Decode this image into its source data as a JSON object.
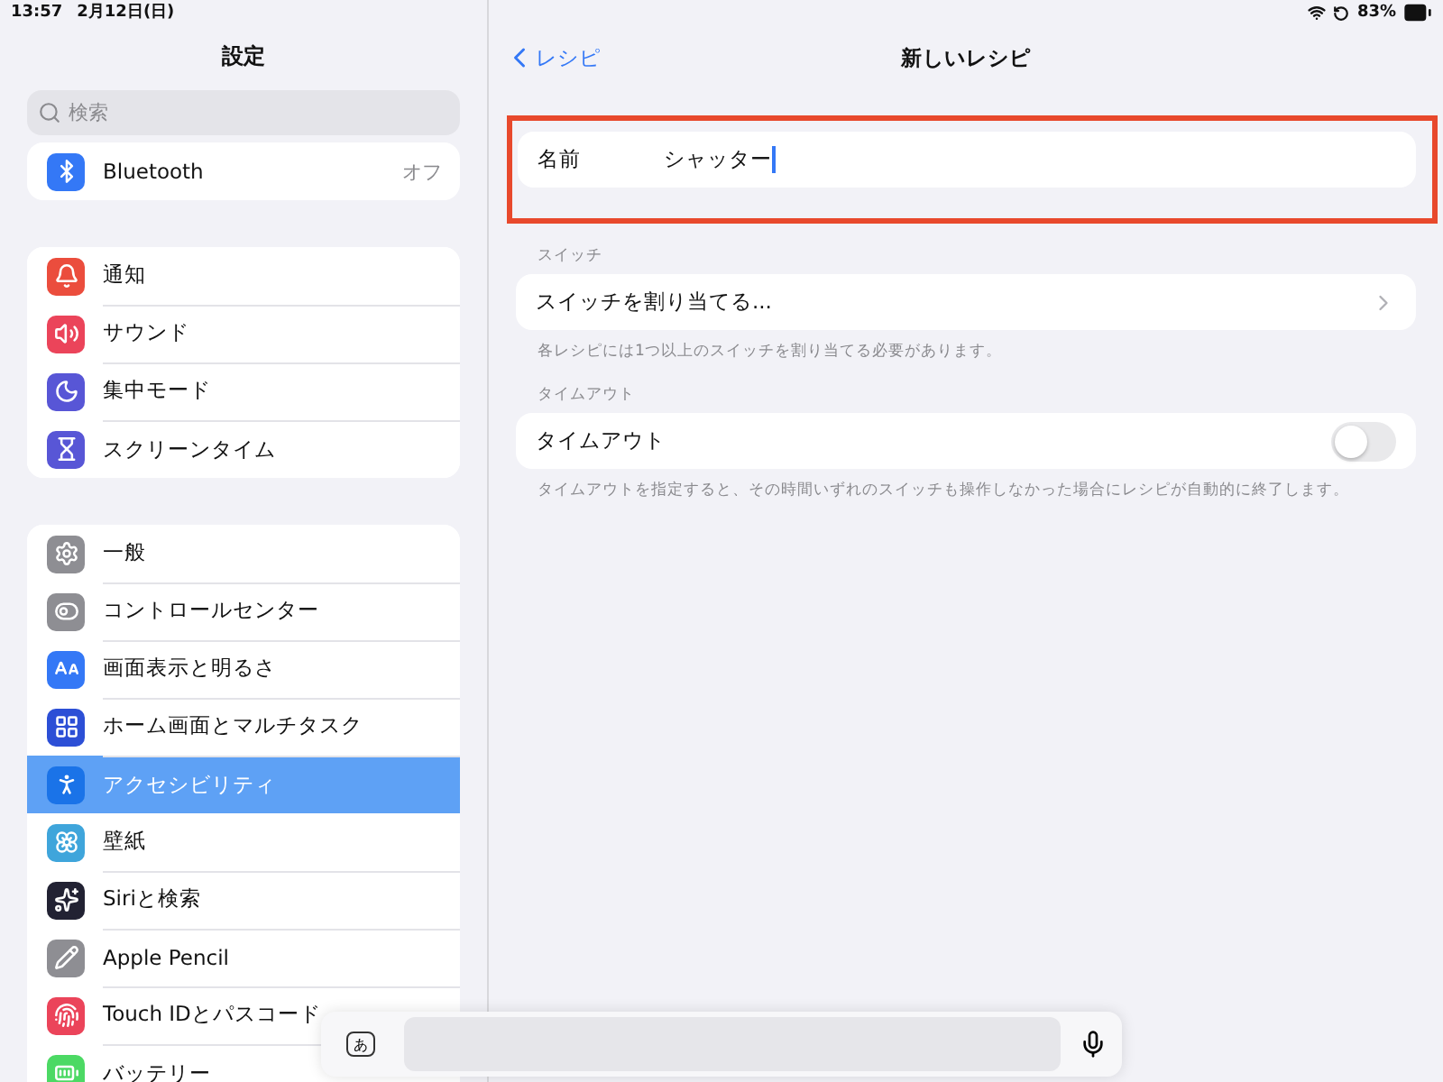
{
  "status_bar": {
    "time": "13:57",
    "date": "2月12日(日)",
    "battery": "83%"
  },
  "sidebar": {
    "title": "設定",
    "search": {
      "placeholder": "検索"
    },
    "groups": [
      {
        "items": [
          {
            "label": "Bluetooth",
            "value": "オフ",
            "color": "#3478f6",
            "selected": false
          }
        ]
      },
      {
        "items": [
          {
            "label": "通知",
            "color": "#eb4d3d",
            "selected": false
          },
          {
            "label": "サウンド",
            "color": "#eb445a",
            "selected": false
          },
          {
            "label": "集中モード",
            "color": "#5856d6",
            "selected": false
          },
          {
            "label": "スクリーンタイム",
            "color": "#5856d6",
            "selected": false
          }
        ]
      },
      {
        "items": [
          {
            "label": "一般",
            "color": "#8e8e93",
            "selected": false
          },
          {
            "label": "コントロールセンター",
            "color": "#8e8e93",
            "selected": false
          },
          {
            "label": "画面表示と明るさ",
            "color": "#3478f6",
            "selected": false
          },
          {
            "label": "ホーム画面とマルチタスク",
            "color": "#2c4fd6",
            "selected": false
          },
          {
            "label": "アクセシビリティ",
            "color": "#1a73e8",
            "selected": true
          },
          {
            "label": "壁紙",
            "color": "#3fa5db",
            "selected": false
          },
          {
            "label": "Siriと検索",
            "color": "#222233",
            "selected": false
          },
          {
            "label": "Apple Pencil",
            "color": "#8e8e93",
            "selected": false
          },
          {
            "label": "Touch IDとパスコード",
            "color": "#eb445a",
            "selected": false
          },
          {
            "label": "バッテリー",
            "color": "#4cd964",
            "selected": false
          }
        ]
      }
    ]
  },
  "detail": {
    "back": "レシピ",
    "title": "新しいレシピ",
    "name_field": {
      "label": "名前",
      "value": "シャッター"
    },
    "sections": [
      {
        "header": "スイッチ",
        "kind": "link",
        "label": "スイッチを割り当てる...",
        "footer": "各レシピには1つ以上のスイッチを割り当てる必要があります。"
      },
      {
        "header": "タイムアウト",
        "kind": "toggle",
        "label": "タイムアウト",
        "on": false,
        "footer": "タイムアウトを指定すると、その時間いずれのスイッチも操作しなかった場合にレシピが自動的に終了します。"
      }
    ]
  },
  "keyboard_bar": {
    "key": "あ"
  }
}
